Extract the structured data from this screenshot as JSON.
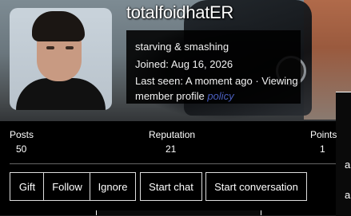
{
  "profile": {
    "username": "totalfoidhatER",
    "custom_title": "starving & smashing",
    "joined": "Joined: Aug 16, 2026",
    "last_seen": "Last seen: A moment ago · Viewing",
    "activity_prefix": "member profile",
    "activity_link": "policy"
  },
  "stats": {
    "posts_label": "Posts",
    "posts_value": "50",
    "reputation_label": "Reputation",
    "reputation_value": "21",
    "points_label": "Points",
    "points_value": "1"
  },
  "actions": {
    "gift": "Gift",
    "follow": "Follow",
    "ignore": "Ignore",
    "start_chat": "Start chat",
    "start_conversation": "Start conversation"
  },
  "edge": {
    "text1": "ai",
    "text2": "a"
  },
  "colors": {
    "link": "#4b5fbf",
    "panel": "#000000"
  }
}
